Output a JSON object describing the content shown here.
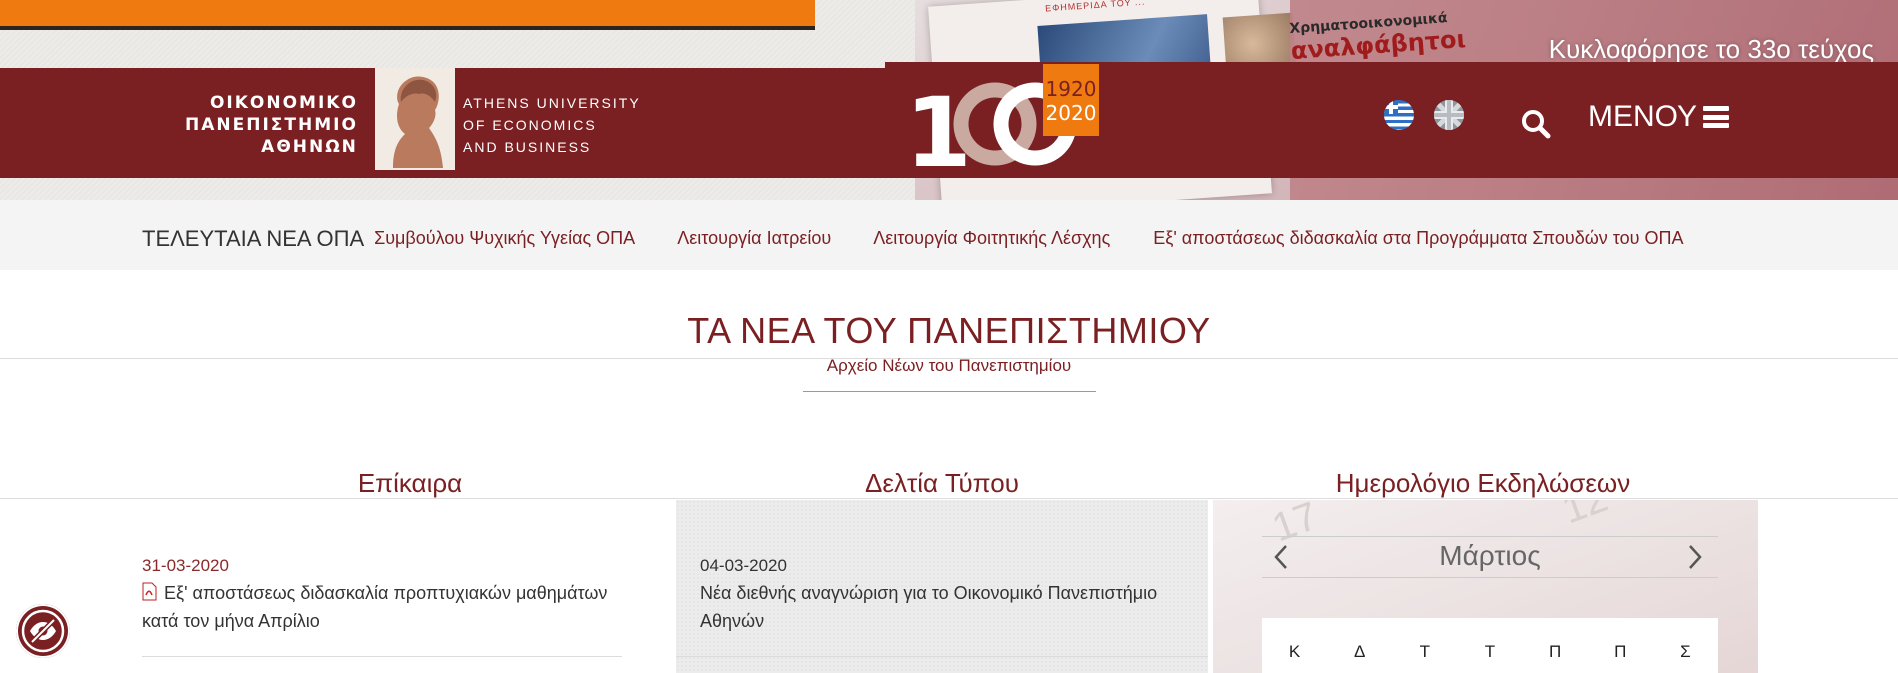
{
  "banner": {
    "circulation_text": "Κυκλοφόρησε το 33ο τεύχος",
    "magazine_headline_small": "Χρηματοοικονομικά",
    "magazine_headline": "αναλφάβητοι",
    "magazine_masthead": "ΕΦΗΜΕΡΙΔΑ ΤΟΥ ..."
  },
  "header": {
    "logo_greek": [
      "ΟΙΚΟΝΟΜΙΚΟ",
      "ΠΑΝΕΠΙΣΤΗΜΙΟ",
      "ΑΘΗΝΩΝ"
    ],
    "logo_english": [
      "ATHENS UNIVERSITY",
      "OF ECONOMICS",
      "AND BUSINESS"
    ],
    "anniversary": {
      "big": "100",
      "years_top": "1920",
      "years_bottom": "2020"
    },
    "search_icon": "search-icon",
    "menu_label": "ΜΕΝΟΥ"
  },
  "ticker": {
    "title": "ΤΕΛΕΥΤΑΙΑ ΝΕΑ ΟΠΑ",
    "items": [
      "ας Συμβούλου Ψυχικής Υγείας ΟΠΑ",
      "Λειτουργία Ιατρείου",
      "Λειτουργία Φοιτητικής Λέσχης",
      "Εξ' αποστάσεως διδασκαλία στα Προγράμματα Σπουδών του ΟΠΑ"
    ]
  },
  "news_section": {
    "title": "ΤΑ ΝΕΑ ΤΟΥ ΠΑΝΕΠΙΣΤΗΜΙΟΥ",
    "archive_link": "Αρχείο Νέων του Πανεπιστημίου"
  },
  "columns": {
    "current": {
      "heading": "Επίκαιρα",
      "items": [
        {
          "date": "31-03-2020",
          "text": "Εξ' αποστάσεως διδασκαλία προπτυχιακών μαθημάτων κατά τον μήνα Απρίλιο"
        }
      ]
    },
    "press": {
      "heading": "Δελτία Τύπου",
      "items": [
        {
          "date": "04-03-2020",
          "text": "Νέα διεθνής αναγνώριση για το Οικονομικό Πανεπιστήμιο Αθηνών"
        }
      ]
    },
    "calendar": {
      "heading": "Ημερολόγιο Εκδηλώσεων",
      "month": "Μάρτιος",
      "weekdays": [
        "Κ",
        "Δ",
        "Τ",
        "Τ",
        "Π",
        "Π",
        "Σ"
      ]
    }
  },
  "colors": {
    "brand": "#7a1f22",
    "orange": "#ef7b10"
  }
}
